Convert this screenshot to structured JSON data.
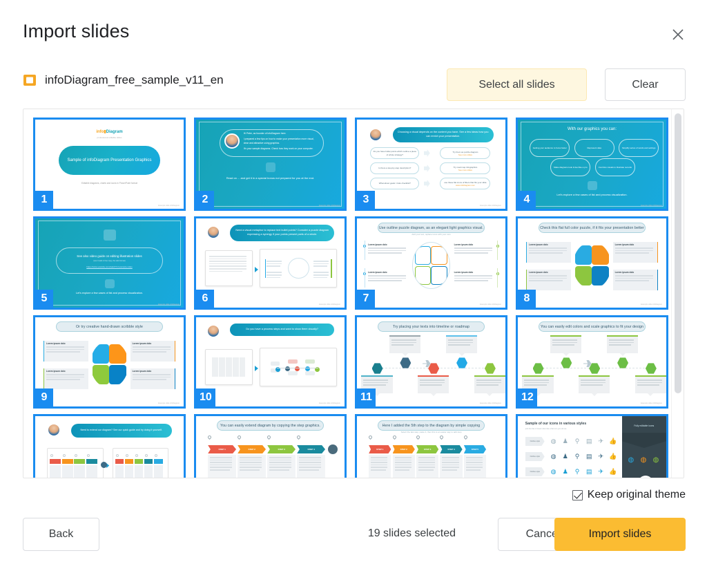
{
  "dialog": {
    "title": "Import slides",
    "close_icon": "close-icon"
  },
  "file": {
    "icon": "presentation-file-icon",
    "name": "infoDiagram_free_sample_v11_en"
  },
  "header_actions": {
    "select_all_label": "Select all slides",
    "clear_label": "Clear"
  },
  "footer": {
    "keep_theme_label": "Keep original theme",
    "keep_theme_checked": true,
    "back_label": "Back",
    "selection_status": "19 slides selected",
    "cancel_label": "Cancel",
    "import_label": "Import slides"
  },
  "colors": {
    "selection_blue": "#1a8cf0",
    "accent_yellow": "#fbbc32",
    "select_all_bg": "#fef7e0",
    "teal": "#16a3b5"
  },
  "slides": [
    {
      "number": "1",
      "selected": true,
      "title": "Sample of infoDiagram Presentation Graphics",
      "subtitle": "Editable diagrams, charts and icons in PowerPoint format",
      "brand": "infoDiagram",
      "brand_sub": "professional editable slides",
      "layout": "title"
    },
    {
      "number": "2",
      "selected": true,
      "title": "Hi Peter, as founder of infoDiagram here.",
      "body": "I prepared a few tips on how to make your presentation more visual, clear and attractive using graphics.",
      "body2": "It's your sample diagrams. Check how they work on your computer.",
      "cta": "Read on ... and get it in a special bonus not prepared for you at the end.",
      "layout": "intro-teal"
    },
    {
      "number": "3",
      "selected": true,
      "title": "Choosing a visual depends on the content you have. See a few ideas how you can enrich your presentation.",
      "layout": "qa-list",
      "rows": [
        {
          "q": "Do you have bullet points which outline a piece of whole strategy?",
          "a": "Try them as puzzle diagram",
          "a_link": "See more slides"
        },
        {
          "q": "Is there a step-by-step description?",
          "a": "Try road map infographics",
          "a_link": "See more slides"
        },
        {
          "q": "What about goals / risks checklist?",
          "a": "use these flat icons of filters that fits your slide",
          "a_link": "www.infoDiagram.com"
        }
      ]
    },
    {
      "number": "4",
      "selected": true,
      "title": "With our graphics you can:",
      "layout": "benefits-teal",
      "bubbles": [
        "Getting your audience to focus faster",
        "Represent data",
        "Simplify series of words and settings",
        "Make diagrams look & feel like a pro",
        "Combine visuals to illustrate records"
      ],
      "cta": "Let's explore a few cases of list and process visualization."
    },
    {
      "number": "5",
      "selected": true,
      "title": "See also video guide on editing illustration slides",
      "subtitle": "(see it safe in free copy, the safe format)",
      "link": "youtube-link",
      "cta": "Let's explore a few cases of list and process visualization.",
      "layout": "video-teal"
    },
    {
      "number": "6",
      "selected": true,
      "title": "Need a visual metaphor to replace text bullet points? Consider a puzzle diagram expressing a synergy if your points present parts of a whole.",
      "layout": "before-after"
    },
    {
      "number": "7",
      "selected": true,
      "title": "Use outline puzzle diagram, as an elegant light graphics visual.",
      "subtitle": "Add your text, replace icons with your own",
      "layout": "puzzle-outline"
    },
    {
      "number": "8",
      "selected": true,
      "title": "Check this flat full color puzzle, if it fits your presentation better",
      "layout": "puzzle-flat"
    },
    {
      "number": "9",
      "selected": true,
      "title": "Or try creative hand-drawn scribble style",
      "layout": "puzzle-scribble"
    },
    {
      "number": "10",
      "selected": true,
      "title": "Do you have a process steps and want to show them visually?",
      "layout": "before-after2"
    },
    {
      "number": "11",
      "selected": true,
      "title": "Try placing your texts into timeline or roadmap",
      "layout": "roadmap-color"
    },
    {
      "number": "12",
      "selected": true,
      "title": "You can easily edit colors and scale graphics to fit your design",
      "layout": "roadmap-green"
    },
    {
      "number": "13",
      "selected": true,
      "title": "Need to extend our diagram? See our quick guide and try doing it yourself.",
      "layout": "extend-steps"
    },
    {
      "number": "14",
      "selected": true,
      "title": "You can easily extend diagram by copying the step graphics.",
      "layout": "steps4"
    },
    {
      "number": "15",
      "selected": true,
      "title": "Here I added the 5th step to the diagram by simple copying",
      "subtitle": "Select the last step, paste it, then this is an easier way to add steps.",
      "layout": "steps5"
    },
    {
      "number": "16",
      "selected": true,
      "title": "Sample of our icons in various styles",
      "subtitle": "pick the flat or linear index like a flat icon you all use",
      "panel_title": "Fully editable icons",
      "layout": "icons-grid"
    }
  ],
  "scrollbar": {
    "name": "slides-scrollbar"
  }
}
